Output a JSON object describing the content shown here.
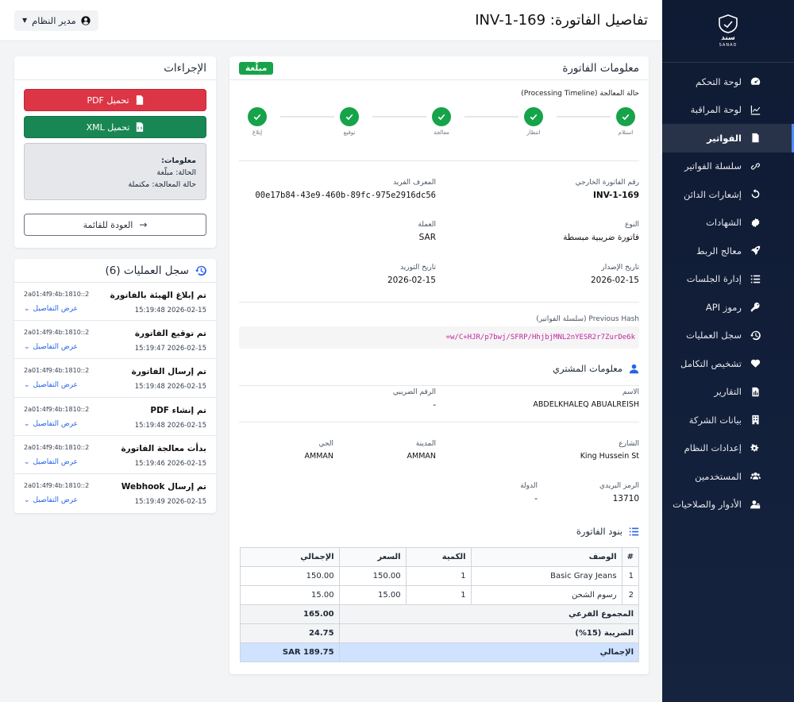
{
  "sidebar": {
    "brand_mark": "سند",
    "brand_name": "SANAD",
    "items": [
      {
        "label": "لوحة التحكم",
        "icon": "tachometer-icon"
      },
      {
        "label": "لوحة المراقبة",
        "icon": "line-chart-icon"
      },
      {
        "label": "الفواتير",
        "icon": "invoice-file-icon",
        "active": true
      },
      {
        "label": "سلسلة الفواتير",
        "icon": "link-icon"
      },
      {
        "label": "إشعارات الدائن",
        "icon": "undo-icon"
      },
      {
        "label": "الشهادات",
        "icon": "certificate-icon"
      },
      {
        "label": "معالج الربط",
        "icon": "rocket-icon"
      },
      {
        "label": "إدارة الجلسات",
        "icon": "list-icon"
      },
      {
        "label": "رموز API",
        "icon": "key-icon"
      },
      {
        "label": "سجل العمليات",
        "icon": "history-icon"
      },
      {
        "label": "تشخيص التكامل",
        "icon": "heartbeat-icon"
      },
      {
        "label": "التقارير",
        "icon": "report-file-icon"
      },
      {
        "label": "بيانات الشركة",
        "icon": "building-icon"
      },
      {
        "label": "إعدادات النظام",
        "icon": "cogs-icon"
      },
      {
        "label": "المستخدمين",
        "icon": "users-icon"
      },
      {
        "label": "الأدوار والصلاحيات",
        "icon": "user-lock-icon"
      }
    ]
  },
  "header": {
    "title": "تفاصيل الفاتورة: INV-1-169",
    "user_label": "مدير النظام"
  },
  "invoice": {
    "card_title": "معلومات الفاتورة",
    "status_badge": "مبلّغة",
    "timeline_title": "حالة المعالجة (Processing Timeline)",
    "timeline_steps": [
      "استلام",
      "انتظار",
      "معالجة",
      "توقيع",
      "إبلاغ"
    ],
    "fields": {
      "external_number_label": "رقم الفاتورة الخارجي",
      "external_number": "INV-1-169",
      "uuid_label": "المعرف الفريد",
      "uuid": "00e17b84-43e9-460b-89fc-975e2916dc56",
      "type_label": "النوع",
      "type": "فاتورة ضريبية مبسطة",
      "currency_label": "العملة",
      "currency": "SAR",
      "issue_date_label": "تاريخ الإصدار",
      "issue_date": "2026-02-15",
      "supply_date_label": "تاريخ التوريد",
      "supply_date": "2026-02-15",
      "prev_hash_label": "Previous Hash (سلسلة الفواتير)",
      "prev_hash": "=w/C+HJR/p7bwj/SFRP/HhjbjMNL2nYESR2r7ZurDe6k"
    },
    "buyer": {
      "title": "معلومات المشتري",
      "name_label": "الاسم",
      "name": "ABDELKHALEQ ABUALREISH",
      "tax_label": "الرقم الضريبي",
      "tax": "-",
      "street_label": "الشارع",
      "street": "King Hussein St",
      "city_label": "المدينة",
      "city": "AMMAN",
      "district_label": "الحي",
      "district": "AMMAN",
      "postal_label": "الرمز البريدي",
      "postal": "13710",
      "country_label": "الدولة",
      "country": "-"
    },
    "items": {
      "title": "بنود الفاتورة",
      "columns": [
        "#",
        "الوصف",
        "الكمية",
        "السعر",
        "الإجمالي"
      ],
      "rows": [
        [
          "1",
          "Basic Gray Jeans",
          "1",
          "150.00",
          "150.00"
        ],
        [
          "2",
          "رسوم الشحن",
          "1",
          "15.00",
          "15.00"
        ]
      ],
      "subtotal_label": "المجموع الفرعي",
      "subtotal": "165.00",
      "tax_label": "الضريبة (15%)",
      "tax": "24.75",
      "total_label": "الإجمالي",
      "total": "SAR 189.75"
    }
  },
  "actions": {
    "title": "الإجراءات",
    "pdf_label": "تحميل PDF",
    "xml_label": "تحميل XML",
    "info_title": "معلومات:",
    "info_status": "الحالة: مبلّغة",
    "info_processing": "حالة المعالجة: مكتملة",
    "back_label": "العودة للقائمة"
  },
  "logs": {
    "title": "سجل العمليات (6)",
    "details_label": "عرض التفاصيل",
    "entries": [
      {
        "title": "تم إبلاغ الهيئة بالفاتورة",
        "time": "2026-02-15 15:19:48",
        "ip": "2a01:4f9:4b:1810::2"
      },
      {
        "title": "تم توقيع الفاتورة",
        "time": "2026-02-15 15:19:47",
        "ip": "2a01:4f9:4b:1810::2"
      },
      {
        "title": "تم إرسال الفاتورة",
        "time": "2026-02-15 15:19:48",
        "ip": "2a01:4f9:4b:1810::2"
      },
      {
        "title": "تم إنشاء PDF",
        "time": "2026-02-15 15:19:48",
        "ip": "2a01:4f9:4b:1810::2"
      },
      {
        "title": "بدأت معالجة الفاتورة",
        "time": "2026-02-15 15:19:46",
        "ip": "2a01:4f9:4b:1810::2"
      },
      {
        "title": "تم إرسال Webhook",
        "time": "2026-02-15 15:19:49",
        "ip": "2a01:4f9:4b:1810::2"
      }
    ]
  },
  "colors": {
    "sidebar_bg": "#0f1a33",
    "success": "#16a34a",
    "danger": "#dc3545",
    "link": "#2563eb",
    "total_row": "#cfe2ff"
  }
}
